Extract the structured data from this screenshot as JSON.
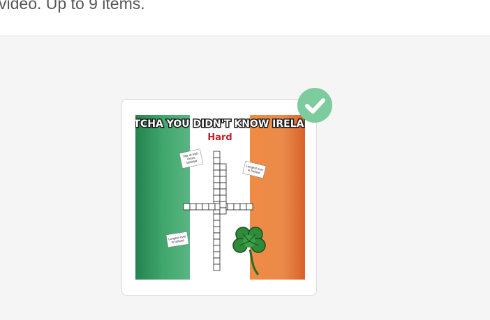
{
  "header": {
    "instruction": "video. Up to 9 items."
  },
  "gallery": {
    "items": [
      {
        "selected": true,
        "check_color": "#7dcc9e",
        "thumbnail": {
          "title": "BETCHA YOU DIDN'T KNOW IRELAND",
          "subtitle": "Hard",
          "notes": [
            "Title of Irish Prime Minister",
            "Longest river in Ireland",
            "Longest river in Ireland"
          ],
          "flag_colors": [
            "#2a8c58",
            "#ffffff",
            "#e07a35"
          ],
          "icon": "shamrock-icon"
        }
      }
    ]
  }
}
